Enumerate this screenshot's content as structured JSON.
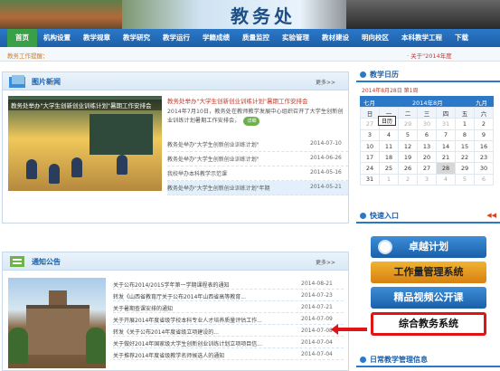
{
  "header": {
    "title": "教务处"
  },
  "nav": {
    "items": [
      "首页",
      "机构设置",
      "教学规章",
      "教学研究",
      "教学运行",
      "学籍成绩",
      "质量监控",
      "实验管理",
      "教材建设",
      "明向校区",
      "本科教学工程",
      "下载"
    ]
  },
  "breadcrumb": "教务工作提醒：",
  "marquee": "· 关于\"2014年度",
  "photo_news": {
    "title": "图片新闻",
    "more": "更多>>",
    "photo_caption": "教务处举办\"大学生创新创业训练计划\"暑期工作安排会",
    "feature_title": "教务处举办\"大学生创新创业训练计划\"暑期工作安排会",
    "feature_body": "2014年7月10日，教务处在教师教学发展中心组织召开了大学生创新创业训练计划暑期工作安排会，",
    "detail_label": "详细",
    "items": [
      {
        "title": "教务处举办\"大学生创新创业训练计划\"",
        "date": "2014-07-10"
      },
      {
        "title": "教务处举办\"大学生创新创业训练计划\"",
        "date": "2014-06-26"
      },
      {
        "title": "我校举办本科教学示范课",
        "date": "2014-05-16"
      },
      {
        "title": "教务处举办\"大学生创新创业训练计划\"年期",
        "date": "2014-05-21"
      }
    ]
  },
  "notices": {
    "title": "通知公告",
    "more": "更多>>",
    "items": [
      {
        "title": "关于公布2014/2015学年第一学期课程表的通知",
        "date": "2014-08-21"
      },
      {
        "title": "转发《山西省教育厅关于公布2014年山西省高等教育...",
        "date": "2014-07-23"
      },
      {
        "title": "关于暑期查课安排的通知",
        "date": "2014-07-21"
      },
      {
        "title": "关于开展2014年度省级学校本科专业人才培养质量评估工作...",
        "date": "2014-07-09"
      },
      {
        "title": "转发《关于公布2014年度省级立项建设的...",
        "date": "2014-07-08"
      },
      {
        "title": "关于做好2014年国家级大学生创新创业训练计划立项项目信...",
        "date": "2014-07-04"
      },
      {
        "title": "关于推荐2014年度省级教学名师候选人的通知",
        "date": "2014-07-04"
      }
    ]
  },
  "calendar": {
    "title": "教学日历",
    "info": "2014年8月28日 第1周",
    "prev": "七月",
    "current": "2014年8月",
    "next": "九月",
    "tooltip": "日历",
    "weekdays": [
      "日",
      "一",
      "二",
      "三",
      "四",
      "五",
      "六"
    ],
    "rows": [
      [
        "27",
        "28",
        "29",
        "30",
        "31",
        "1",
        "2"
      ],
      [
        "3",
        "4",
        "5",
        "6",
        "7",
        "8",
        "9"
      ],
      [
        "10",
        "11",
        "12",
        "13",
        "14",
        "15",
        "16"
      ],
      [
        "17",
        "18",
        "19",
        "20",
        "21",
        "22",
        "23"
      ],
      [
        "24",
        "25",
        "26",
        "27",
        "28",
        "29",
        "30"
      ],
      [
        "31",
        "1",
        "2",
        "3",
        "4",
        "5",
        "6"
      ]
    ],
    "selected_day": "28"
  },
  "quick_entry": {
    "title": "快速入口",
    "buttons": [
      "卓越计划",
      "工作量管理系统",
      "精品视频公开课",
      "综合教务系统"
    ]
  },
  "daily_info": {
    "title": "日常教学管理信息"
  }
}
